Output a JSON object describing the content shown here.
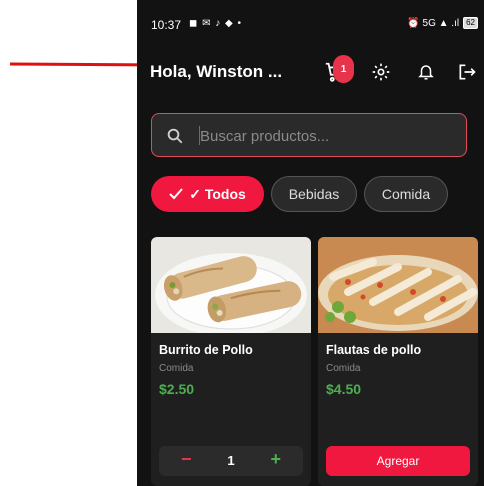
{
  "status_bar": {
    "time": "10:37",
    "left_icons": "◼ ✉ ♪ ◆ •",
    "right_icons": "⏰ 5G ▲ .ıl",
    "battery": "62"
  },
  "header": {
    "greeting": "Hola, Winston ...",
    "cart_count": "1",
    "icons": [
      "cart-icon",
      "gear-icon",
      "bell-icon",
      "logout-icon"
    ]
  },
  "search": {
    "placeholder": "Buscar productos..."
  },
  "filters": [
    {
      "label": "✓ Todos",
      "active": true
    },
    {
      "label": "Bebidas",
      "active": false
    },
    {
      "label": "Comida",
      "active": false
    }
  ],
  "products": [
    {
      "name": "Burrito de Pollo",
      "category": "Comida",
      "price": "$2.50",
      "quantity": "1",
      "minus": "−",
      "plus": "+"
    },
    {
      "name": "Flautas de pollo",
      "category": "Comida",
      "price": "$4.50",
      "add_label": "Agregar"
    }
  ],
  "colors": {
    "accent": "#f0183f",
    "price": "#4caf50",
    "background": "#121212",
    "card": "#1f1f1f",
    "annotation_arrow": "#e01010"
  }
}
